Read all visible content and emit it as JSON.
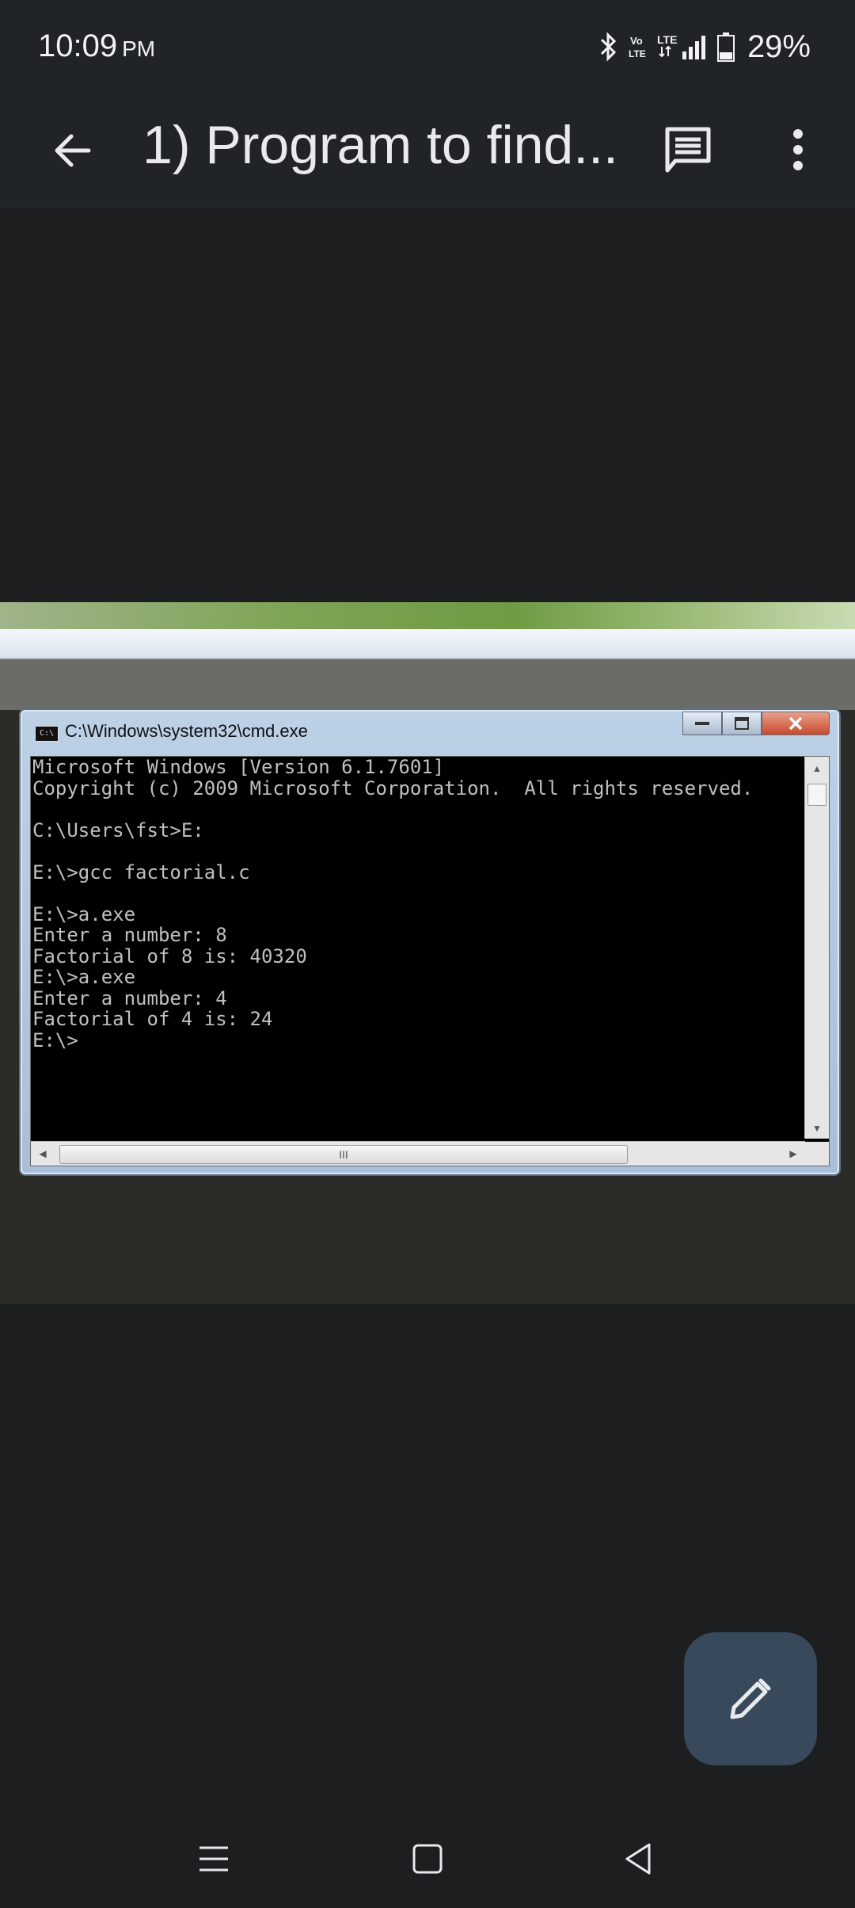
{
  "status_bar": {
    "time": "10:09",
    "ampm": "PM",
    "network": "LTE",
    "volte": "Vo LTE",
    "battery_percent": "29%"
  },
  "app_bar": {
    "title": "1) Program to find..."
  },
  "screenshot": {
    "window_title": "C:\\Windows\\system32\\cmd.exe",
    "console_lines": [
      "Microsoft Windows [Version 6.1.7601]",
      "Copyright (c) 2009 Microsoft Corporation.  All rights reserved.",
      "",
      "C:\\Users\\fst>E:",
      "",
      "E:\\>gcc factorial.c",
      "",
      "E:\\>a.exe",
      "Enter a number: 8",
      "Factorial of 8 is: 40320",
      "E:\\>a.exe",
      "Enter a number: 4",
      "Factorial of 4 is: 24",
      "E:\\>"
    ],
    "scroll_thumb_label": "III"
  },
  "icons": {
    "back": "arrow-left",
    "comment": "comment",
    "more": "more-vertical",
    "edit": "pencil",
    "nav_recent": "menu-lines",
    "nav_home": "square",
    "nav_back": "triangle-left"
  }
}
